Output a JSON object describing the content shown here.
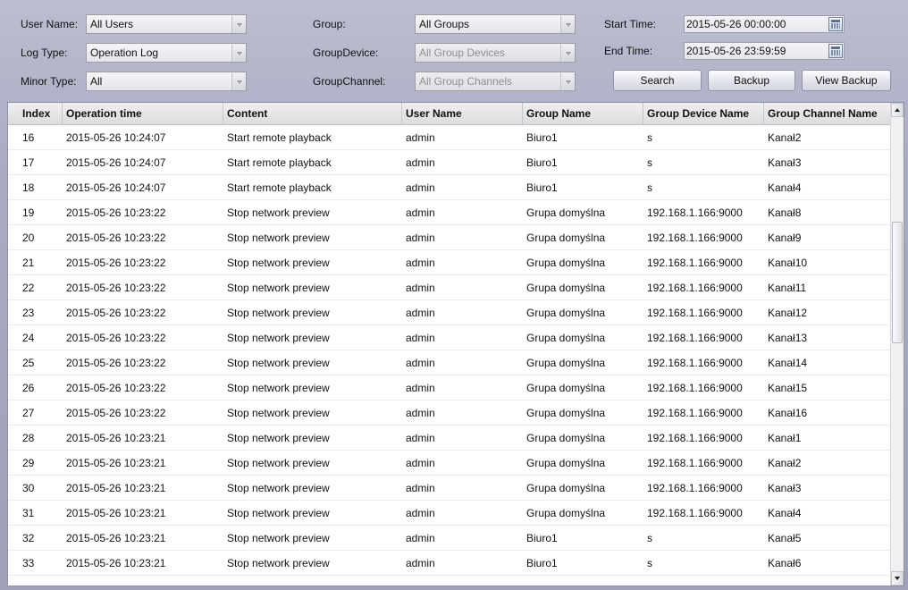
{
  "filters": {
    "user_name_label": "User Name:",
    "user_name_value": "All Users",
    "log_type_label": "Log Type:",
    "log_type_value": "Operation Log",
    "minor_type_label": "Minor Type:",
    "minor_type_value": "All",
    "group_label": "Group:",
    "group_value": "All Groups",
    "group_device_label": "GroupDevice:",
    "group_device_value": "All Group Devices",
    "group_channel_label": "GroupChannel:",
    "group_channel_value": "All Group Channels",
    "start_time_label": "Start Time:",
    "start_time_value": "2015-05-26 00:00:00",
    "end_time_label": "End Time:",
    "end_time_value": "2015-05-26 23:59:59"
  },
  "buttons": {
    "search": "Search",
    "backup": "Backup",
    "view_backup": "View Backup"
  },
  "table": {
    "headers": [
      "Index",
      "Operation time",
      "Content",
      "User Name",
      "Group Name",
      "Group Device Name",
      "Group Channel Name"
    ],
    "rows": [
      [
        "16",
        "2015-05-26 10:24:07",
        "Start remote playback",
        "admin",
        "Biuro1",
        "s",
        "Kanał2"
      ],
      [
        "17",
        "2015-05-26 10:24:07",
        "Start remote playback",
        "admin",
        "Biuro1",
        "s",
        "Kanał3"
      ],
      [
        "18",
        "2015-05-26 10:24:07",
        "Start remote playback",
        "admin",
        "Biuro1",
        "s",
        "Kanał4"
      ],
      [
        "19",
        "2015-05-26 10:23:22",
        "Stop network preview",
        "admin",
        "Grupa domyślna",
        "192.168.1.166:9000",
        "Kanał8"
      ],
      [
        "20",
        "2015-05-26 10:23:22",
        "Stop network preview",
        "admin",
        "Grupa domyślna",
        "192.168.1.166:9000",
        "Kanał9"
      ],
      [
        "21",
        "2015-05-26 10:23:22",
        "Stop network preview",
        "admin",
        "Grupa domyślna",
        "192.168.1.166:9000",
        "Kanał10"
      ],
      [
        "22",
        "2015-05-26 10:23:22",
        "Stop network preview",
        "admin",
        "Grupa domyślna",
        "192.168.1.166:9000",
        "Kanał11"
      ],
      [
        "23",
        "2015-05-26 10:23:22",
        "Stop network preview",
        "admin",
        "Grupa domyślna",
        "192.168.1.166:9000",
        "Kanał12"
      ],
      [
        "24",
        "2015-05-26 10:23:22",
        "Stop network preview",
        "admin",
        "Grupa domyślna",
        "192.168.1.166:9000",
        "Kanał13"
      ],
      [
        "25",
        "2015-05-26 10:23:22",
        "Stop network preview",
        "admin",
        "Grupa domyślna",
        "192.168.1.166:9000",
        "Kanał14"
      ],
      [
        "26",
        "2015-05-26 10:23:22",
        "Stop network preview",
        "admin",
        "Grupa domyślna",
        "192.168.1.166:9000",
        "Kanał15"
      ],
      [
        "27",
        "2015-05-26 10:23:22",
        "Stop network preview",
        "admin",
        "Grupa domyślna",
        "192.168.1.166:9000",
        "Kanał16"
      ],
      [
        "28",
        "2015-05-26 10:23:21",
        "Stop network preview",
        "admin",
        "Grupa domyślna",
        "192.168.1.166:9000",
        "Kanał1"
      ],
      [
        "29",
        "2015-05-26 10:23:21",
        "Stop network preview",
        "admin",
        "Grupa domyślna",
        "192.168.1.166:9000",
        "Kanał2"
      ],
      [
        "30",
        "2015-05-26 10:23:21",
        "Stop network preview",
        "admin",
        "Grupa domyślna",
        "192.168.1.166:9000",
        "Kanał3"
      ],
      [
        "31",
        "2015-05-26 10:23:21",
        "Stop network preview",
        "admin",
        "Grupa domyślna",
        "192.168.1.166:9000",
        "Kanał4"
      ],
      [
        "32",
        "2015-05-26 10:23:21",
        "Stop network preview",
        "admin",
        "Biuro1",
        "s",
        "Kanał5"
      ],
      [
        "33",
        "2015-05-26 10:23:21",
        "Stop network preview",
        "admin",
        "Biuro1",
        "s",
        "Kanał6"
      ]
    ]
  },
  "icons": {
    "dropdown": "chevron-down-icon",
    "calendar": "calendar-icon",
    "scroll_up": "scroll-up-arrow-icon",
    "scroll_down": "scroll-down-arrow-icon"
  },
  "colors": {
    "panel_background": "#a9abc2",
    "header_background": "#dcdcdf",
    "disabled_text": "#8e8e98"
  }
}
